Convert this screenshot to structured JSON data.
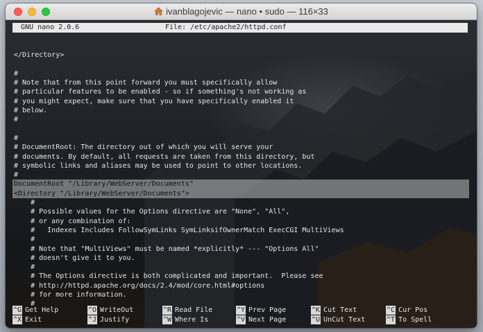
{
  "window": {
    "title": "ivanblagojevic — nano • sudo — 116×33"
  },
  "nano": {
    "version": "GNU nano 2.0.6",
    "file": "File: /etc/apache2/httpd.conf"
  },
  "lines": [
    {
      "text": "",
      "hl": false
    },
    {
      "text": "</Directory>",
      "hl": false
    },
    {
      "text": "",
      "hl": false
    },
    {
      "text": "#",
      "hl": false
    },
    {
      "text": "# Note that from this point forward you must specifically allow",
      "hl": false
    },
    {
      "text": "# particular features to be enabled - so if something's not working as",
      "hl": false
    },
    {
      "text": "# you might expect, make sure that you have specifically enabled it",
      "hl": false
    },
    {
      "text": "# below.",
      "hl": false
    },
    {
      "text": "#",
      "hl": false
    },
    {
      "text": "",
      "hl": false
    },
    {
      "text": "#",
      "hl": false
    },
    {
      "text": "# DocumentRoot: The directory out of which you will serve your",
      "hl": false
    },
    {
      "text": "# documents. By default, all requests are taken from this directory, but",
      "hl": false
    },
    {
      "text": "# symbolic links and aliases may be used to point to other locations.",
      "hl": false
    },
    {
      "text": "#",
      "hl": false
    },
    {
      "text": "DocumentRoot \"/Library/WebServer/Documents\"",
      "hl": true
    },
    {
      "text": "<Directory \"/Library/WebServer/Documents\">",
      "hl": true
    },
    {
      "text": "    #",
      "hl": false
    },
    {
      "text": "    # Possible values for the Options directive are \"None\", \"All\",",
      "hl": false
    },
    {
      "text": "    # or any combination of:",
      "hl": false
    },
    {
      "text": "    #   Indexes Includes FollowSymLinks SymLinksifOwnerMatch ExecCGI MultiViews",
      "hl": false
    },
    {
      "text": "    #",
      "hl": false
    },
    {
      "text": "    # Note that \"MultiViews\" must be named *explicitly* --- \"Options All\"",
      "hl": false
    },
    {
      "text": "    # doesn't give it to you.",
      "hl": false
    },
    {
      "text": "    #",
      "hl": false
    },
    {
      "text": "    # The Options directive is both complicated and important.  Please see",
      "hl": false
    },
    {
      "text": "    # http://httpd.apache.org/docs/2.4/mod/core.html#options",
      "hl": false
    },
    {
      "text": "    # for more information.",
      "hl": false
    },
    {
      "text": "    #",
      "hl": false
    }
  ],
  "shortcuts": [
    {
      "key": "^G",
      "label": "Get Help"
    },
    {
      "key": "^O",
      "label": "WriteOut"
    },
    {
      "key": "^R",
      "label": "Read File"
    },
    {
      "key": "^Y",
      "label": "Prev Page"
    },
    {
      "key": "^K",
      "label": "Cut Text"
    },
    {
      "key": "^C",
      "label": "Cur Pos"
    },
    {
      "key": "^X",
      "label": "Exit"
    },
    {
      "key": "^J",
      "label": "Justify"
    },
    {
      "key": "^W",
      "label": "Where Is"
    },
    {
      "key": "^V",
      "label": "Next Page"
    },
    {
      "key": "^U",
      "label": "UnCut Text"
    },
    {
      "key": "^T",
      "label": "To Spell"
    }
  ]
}
